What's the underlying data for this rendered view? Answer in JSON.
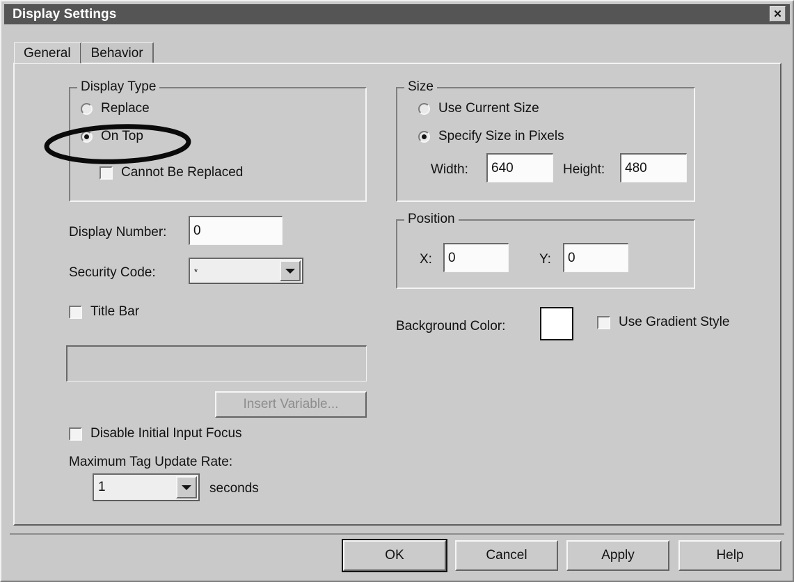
{
  "window": {
    "title": "Display Settings",
    "close_icon": "close-icon",
    "close_glyph": "✕"
  },
  "tabs": [
    {
      "label": "General",
      "active": true
    },
    {
      "label": "Behavior",
      "active": false
    }
  ],
  "general": {
    "display_type": {
      "legend": "Display Type",
      "options": [
        {
          "label": "Replace",
          "selected": false
        },
        {
          "label": "On Top",
          "selected": true
        }
      ],
      "cannot_be_replaced": {
        "label": "Cannot Be Replaced",
        "checked": false
      },
      "annotation": "black-ellipse-highlight-on-top"
    },
    "display_number": {
      "label": "Display Number:",
      "value": "0"
    },
    "security_code": {
      "label": "Security Code:",
      "value": "*",
      "arrow_icon": "chevron-down-icon"
    },
    "title_bar": {
      "label": "Title Bar",
      "checked": false,
      "text_value": "",
      "enabled": false
    },
    "insert_variable_button": {
      "label": "Insert Variable...",
      "enabled": false
    },
    "disable_initial_input_focus": {
      "label": "Disable Initial Input Focus",
      "checked": false
    },
    "max_tag_update_rate": {
      "label": "Maximum Tag Update Rate:",
      "value": "1",
      "unit": "seconds",
      "arrow_icon": "chevron-down-icon"
    },
    "size": {
      "legend": "Size",
      "options": [
        {
          "label": "Use Current Size",
          "selected": false
        },
        {
          "label": "Specify Size in Pixels",
          "selected": true
        }
      ],
      "width": {
        "label": "Width:",
        "value": "640"
      },
      "height": {
        "label": "Height:",
        "value": "480"
      }
    },
    "position": {
      "legend": "Position",
      "x": {
        "label": "X:",
        "value": "0"
      },
      "y": {
        "label": "Y:",
        "value": "0"
      }
    },
    "background_color": {
      "label": "Background Color:",
      "color": "#ffffff"
    },
    "use_gradient_style": {
      "label": "Use Gradient Style",
      "checked": false
    }
  },
  "footer": {
    "ok": "OK",
    "cancel": "Cancel",
    "apply": "Apply",
    "help": "Help"
  }
}
